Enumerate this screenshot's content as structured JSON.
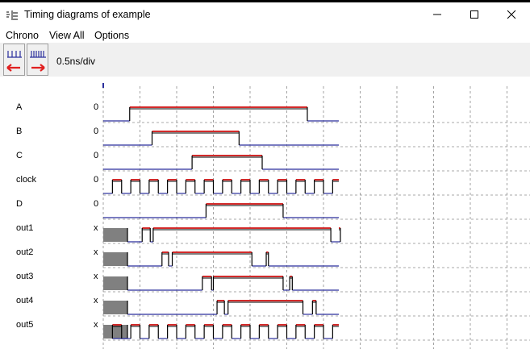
{
  "window": {
    "title": "Timing diagrams of example"
  },
  "menu": [
    {
      "label": "Chrono"
    },
    {
      "label": "View All"
    },
    {
      "label": "Options"
    }
  ],
  "toolbar": {
    "scale_label": "0.5ns/div",
    "zoom_out_icon": "wide-ticks-icon",
    "zoom_in_icon": "dense-ticks-icon",
    "scroll_left_icon": "red-arrow-left-icon",
    "scroll_right_icon": "red-arrow-right-icon"
  },
  "colors": {
    "high_line": "#d32a2a",
    "low_line": "#2b2f9c",
    "edge": "#000000",
    "unknown_fill": "#808080",
    "grid": "#8c8c8c",
    "tick_red": "#e02020"
  },
  "chart_data": {
    "type": "timing",
    "time_unit": "div",
    "time_range": [
      0,
      6.5
    ],
    "grid": true,
    "clock_period": 0.4,
    "signals": [
      {
        "name": "A",
        "initial": "0",
        "transitions": [
          [
            0.72,
            1
          ],
          [
            5.56,
            0
          ]
        ]
      },
      {
        "name": "B",
        "initial": "0",
        "transitions": [
          [
            1.33,
            1
          ],
          [
            3.7,
            0
          ]
        ]
      },
      {
        "name": "C",
        "initial": "0",
        "transitions": [
          [
            2.42,
            1
          ],
          [
            4.33,
            0
          ]
        ]
      },
      {
        "name": "clock",
        "initial": "0",
        "clock": true,
        "first_edge": 0.25,
        "period": 0.5
      },
      {
        "name": "D",
        "initial": "0",
        "transitions": [
          [
            2.8,
            1
          ],
          [
            4.9,
            0
          ]
        ]
      },
      {
        "name": "out1",
        "initial": "x",
        "transitions": [
          [
            0.66,
            0
          ],
          [
            1.06,
            1
          ],
          [
            1.28,
            0
          ],
          [
            1.36,
            1
          ],
          [
            6.2,
            0
          ],
          [
            6.46,
            1
          ]
        ]
      },
      {
        "name": "out2",
        "initial": "x",
        "transitions": [
          [
            0.66,
            0
          ],
          [
            1.6,
            1
          ],
          [
            1.78,
            0
          ],
          [
            1.88,
            1
          ],
          [
            4.05,
            0
          ],
          [
            4.44,
            1
          ],
          [
            4.5,
            0
          ]
        ]
      },
      {
        "name": "out3",
        "initial": "x",
        "transitions": [
          [
            0.66,
            0
          ],
          [
            2.7,
            1
          ],
          [
            2.95,
            0
          ],
          [
            3.0,
            1
          ],
          [
            4.9,
            0
          ],
          [
            5.08,
            1
          ],
          [
            5.15,
            0
          ]
        ]
      },
      {
        "name": "out4",
        "initial": "x",
        "transitions": [
          [
            0.66,
            0
          ],
          [
            3.1,
            1
          ],
          [
            3.3,
            0
          ],
          [
            3.4,
            1
          ],
          [
            5.44,
            0
          ],
          [
            5.7,
            1
          ],
          [
            5.8,
            0
          ]
        ]
      },
      {
        "name": "out5",
        "initial": "x",
        "clock": true,
        "first_edge": 0.25,
        "period": 0.5,
        "invert": false
      }
    ]
  }
}
